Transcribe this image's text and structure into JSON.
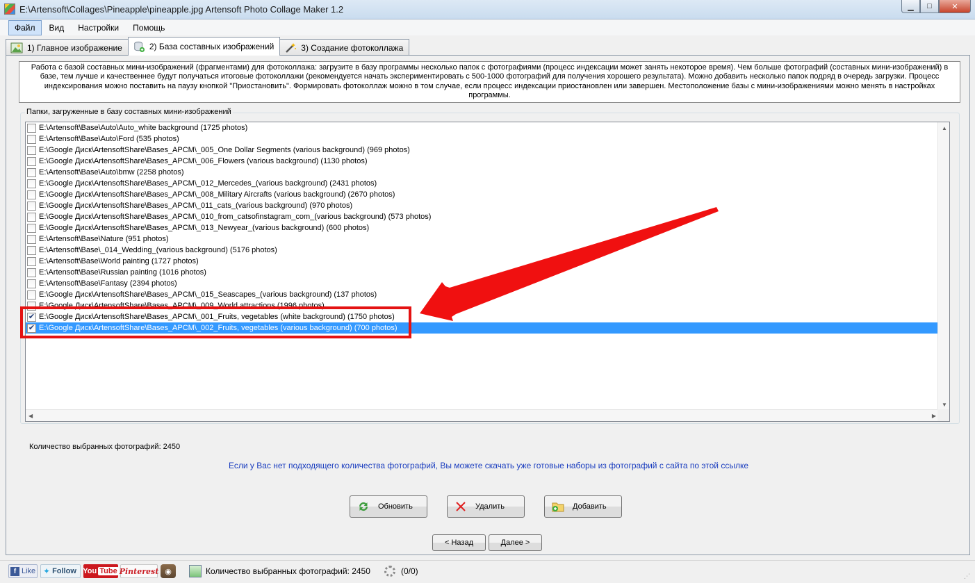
{
  "window": {
    "title": "E:\\Artensoft\\Collages\\Pineapple\\pineapple.jpg Artensoft Photo Collage Maker 1.2",
    "minimize": "▁",
    "maximize": "□",
    "close": "✕"
  },
  "menu": {
    "items": [
      "Файл",
      "Вид",
      "Настройки",
      "Помощь"
    ]
  },
  "tabs": [
    {
      "label": "1) Главное изображение",
      "icon": "image-icon"
    },
    {
      "label": "2) База составных изображений",
      "icon": "database-add-icon"
    },
    {
      "label": "3) Создание фотоколлажа",
      "icon": "magic-wand-icon"
    }
  ],
  "info": {
    "text": "Работа с базой составных мини-изображений (фрагментами) для фотоколлажа: загрузите в базу программы несколько папок с фотографиями (процесс индексации может занять некоторое время). Чем больше фотографий (составных мини-изображений) в базе, тем лучше и качественнее будут получаться итоговые фотоколлажи (рекомендуется начать экспериментировать с 500-1000 фотографий для получения хорошего результата). Можно добавить несколько папок подряд в очередь загрузки. Процесс индексирования можно поставить на паузу кнопкой \"Приостановить\". Формировать фотоколлаж можно в том случае, если процесс индексации приостановлен или завершен. Местоположение базы с мини-изображениями можно менять в настройках программы."
  },
  "folders": {
    "group_label": "Папки, загруженные в базу составных мини-изображений",
    "items": [
      {
        "path": "E:\\Artensoft\\Base\\Auto\\Auto_white background (1725 photos)",
        "checked": false
      },
      {
        "path": "E:\\Artensoft\\Base\\Auto\\Ford (535 photos)",
        "checked": false
      },
      {
        "path": "E:\\Google Диск\\ArtensoftShare\\Bases_APCM\\_005_One Dollar Segments (various background) (969 photos)",
        "checked": false
      },
      {
        "path": "E:\\Google Диск\\ArtensoftShare\\Bases_APCM\\_006_Flowers (various background) (1130 photos)",
        "checked": false
      },
      {
        "path": "E:\\Artensoft\\Base\\Auto\\bmw (2258 photos)",
        "checked": false
      },
      {
        "path": "E:\\Google Диск\\ArtensoftShare\\Bases_APCM\\_012_Mercedes_(various background) (2431 photos)",
        "checked": false
      },
      {
        "path": "E:\\Google Диск\\ArtensoftShare\\Bases_APCM\\_008_Military Aircrafts (various background) (2670 photos)",
        "checked": false
      },
      {
        "path": "E:\\Google Диск\\ArtensoftShare\\Bases_APCM\\_011_cats_(various background) (970 photos)",
        "checked": false
      },
      {
        "path": "E:\\Google Диск\\ArtensoftShare\\Bases_APCM\\_010_from_catsofinstagram_com_(various background) (573 photos)",
        "checked": false
      },
      {
        "path": "E:\\Google Диск\\ArtensoftShare\\Bases_APCM\\_013_Newyear_(various background) (600 photos)",
        "checked": false
      },
      {
        "path": "E:\\Artensoft\\Base\\Nature (951 photos)",
        "checked": false
      },
      {
        "path": "E:\\Artensoft\\Base\\_014_Wedding_(various background) (5176 photos)",
        "checked": false
      },
      {
        "path": "E:\\Artensoft\\Base\\World painting (1727 photos)",
        "checked": false
      },
      {
        "path": "E:\\Artensoft\\Base\\Russian painting (1016 photos)",
        "checked": false
      },
      {
        "path": "E:\\Artensoft\\Base\\Fantasy (2394 photos)",
        "checked": false
      },
      {
        "path": "E:\\Google Диск\\ArtensoftShare\\Bases_APCM\\_015_Seascapes_(various background) (137 photos)",
        "checked": false
      },
      {
        "path": "E:\\Google Диск\\ArtensoftShare\\Bases_APCM\\_009_World attractions (1996 photos)",
        "checked": false
      },
      {
        "path": "E:\\Google Диск\\ArtensoftShare\\Bases_APCM\\_001_Fruits, vegetables (white background) (1750 photos)",
        "checked": true
      },
      {
        "path": "E:\\Google Диск\\ArtensoftShare\\Bases_APCM\\_002_Fruits, vegetables (various background) (700 photos)",
        "checked": true,
        "selected": true
      }
    ]
  },
  "selected_count": "Количество выбранных фотографий: 2450",
  "download_link": "Если у Вас нет подходящего количества фотографий, Вы можете скачать уже готовые наборы из фотографий с сайта по этой ссылке",
  "buttons": {
    "refresh": "Обновить",
    "delete": "Удалить",
    "add": "Добавить",
    "back": "< Назад",
    "next": "Далее >"
  },
  "statusbar": {
    "like": "Like",
    "follow": "Follow",
    "youtube_you": "You",
    "youtube_tube": "Tube",
    "pinterest": "Pinterest",
    "count": "Количество выбранных фотографий: 2450",
    "progress": "(0/0)"
  },
  "colors": {
    "selection": "#3399ff",
    "highlight": "#e41212",
    "link": "#1a3dbf"
  }
}
